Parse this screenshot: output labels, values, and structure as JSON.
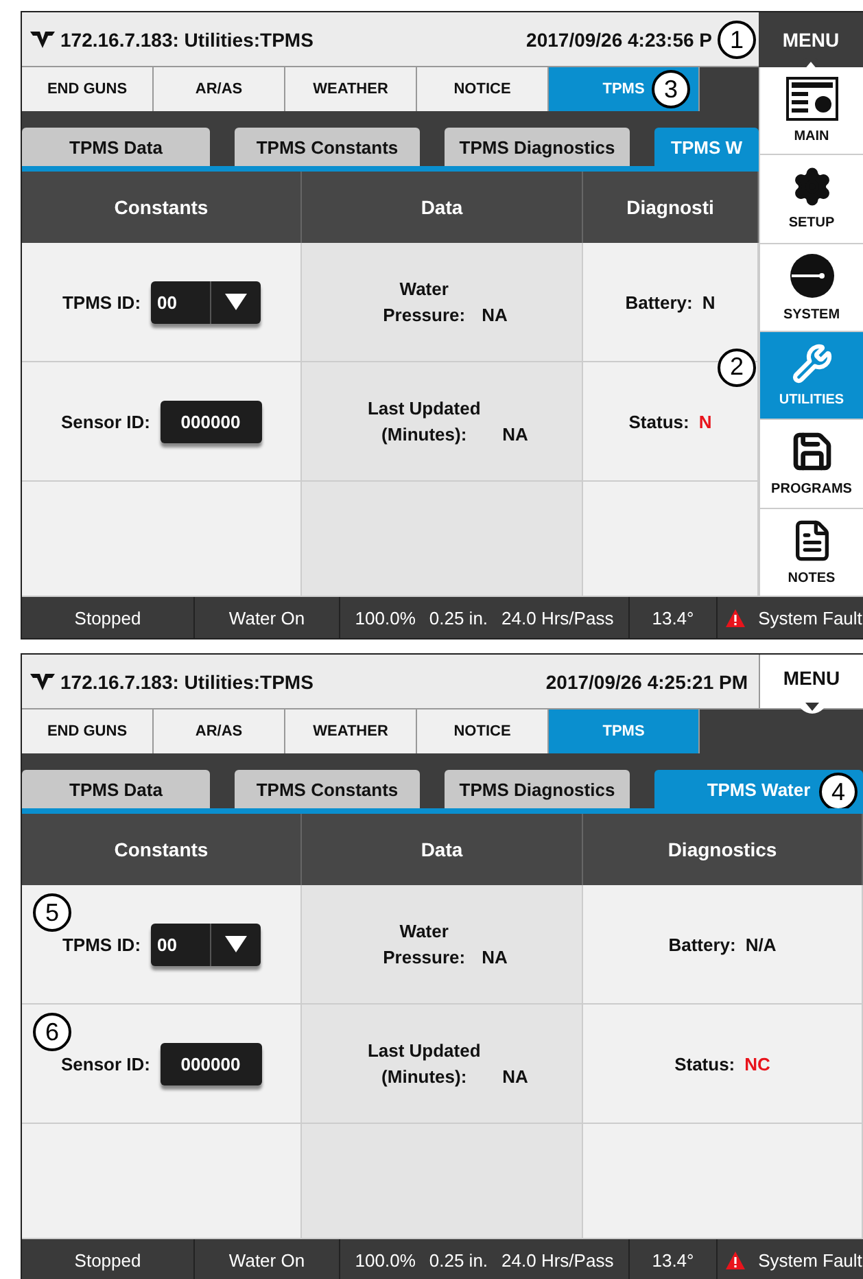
{
  "screens": [
    {
      "title": "172.16.7.183: Utilities:TPMS",
      "datetime": "2017/09/26 4:23:56 P",
      "menu": {
        "label": "MENU",
        "open": true,
        "callout": "1",
        "items": [
          {
            "label": "MAIN",
            "kind": "main",
            "selected": false
          },
          {
            "label": "SETUP",
            "kind": "setup",
            "selected": false
          },
          {
            "label": "SYSTEM",
            "kind": "system",
            "selected": false
          },
          {
            "label": "UTILITIES",
            "kind": "utilities",
            "selected": true,
            "callout": "2"
          },
          {
            "label": "PROGRAMS",
            "kind": "programs",
            "selected": false
          },
          {
            "label": "NOTES",
            "kind": "notes",
            "selected": false
          }
        ]
      },
      "tabs": [
        {
          "label": "END GUNS",
          "selected": false
        },
        {
          "label": "AR/AS",
          "selected": false
        },
        {
          "label": "WEATHER",
          "selected": false
        },
        {
          "label": "NOTICE",
          "selected": false
        },
        {
          "label": "TPMS",
          "selected": true,
          "callout": "3"
        }
      ],
      "subtabs": [
        {
          "label": "TPMS Data",
          "selected": false
        },
        {
          "label": "TPMS Constants",
          "selected": false
        },
        {
          "label": "TPMS Diagnostics",
          "selected": false
        },
        {
          "label": "TPMS W",
          "selected": true
        }
      ],
      "table": {
        "columns": [
          "Constants",
          "Data",
          "Diagnosti"
        ],
        "rows": [
          {
            "constant": {
              "label": "TPMS ID:",
              "kind": "dropdown",
              "value": "00"
            },
            "data": {
              "label": "Water Pressure:",
              "value": "NA"
            },
            "diagnostic": {
              "label": "Battery:",
              "value": "N",
              "alert": false
            }
          },
          {
            "constant": {
              "label": "Sensor ID:",
              "kind": "field",
              "value": "000000"
            },
            "data": {
              "label": "Last Updated (Minutes):",
              "value": "NA"
            },
            "diagnostic": {
              "label": "Status:",
              "value": "N",
              "alert": true
            }
          }
        ]
      },
      "status_bar": [
        {
          "kind": "plain",
          "texts": [
            "Stopped"
          ]
        },
        {
          "kind": "plain",
          "texts": [
            "Water On"
          ]
        },
        {
          "kind": "plain",
          "texts": [
            "100.0%",
            "0.25 in.",
            "24.0 Hrs/Pass"
          ]
        },
        {
          "kind": "plain",
          "texts": [
            "13.4°"
          ]
        },
        {
          "kind": "fault",
          "texts": [
            "System Fault"
          ]
        }
      ]
    },
    {
      "title": "172.16.7.183: Utilities:TPMS",
      "datetime": "2017/09/26 4:25:21 PM",
      "menu": {
        "label": "MENU",
        "open": false
      },
      "tabs": [
        {
          "label": "END GUNS",
          "selected": false
        },
        {
          "label": "AR/AS",
          "selected": false
        },
        {
          "label": "WEATHER",
          "selected": false
        },
        {
          "label": "NOTICE",
          "selected": false
        },
        {
          "label": "TPMS",
          "selected": true
        }
      ],
      "subtabs": [
        {
          "label": "TPMS Data",
          "selected": false
        },
        {
          "label": "TPMS Constants",
          "selected": false
        },
        {
          "label": "TPMS Diagnostics",
          "selected": false
        },
        {
          "label": "TPMS Water",
          "selected": true,
          "callout": "4"
        }
      ],
      "table": {
        "columns": [
          "Constants",
          "Data",
          "Diagnostics"
        ],
        "rows": [
          {
            "constant": {
              "label": "TPMS ID:",
              "kind": "dropdown",
              "value": "00",
              "callout": "5"
            },
            "data": {
              "label": "Water Pressure:",
              "value": "NA"
            },
            "diagnostic": {
              "label": "Battery:",
              "value": "N/A",
              "alert": false
            }
          },
          {
            "constant": {
              "label": "Sensor ID:",
              "kind": "field",
              "value": "000000",
              "callout": "6"
            },
            "data": {
              "label": "Last Updated (Minutes):",
              "value": "NA"
            },
            "diagnostic": {
              "label": "Status:",
              "value": "NC",
              "alert": true
            }
          }
        ]
      },
      "status_bar": [
        {
          "kind": "plain",
          "texts": [
            "Stopped"
          ]
        },
        {
          "kind": "plain",
          "texts": [
            "Water On"
          ]
        },
        {
          "kind": "plain",
          "texts": [
            "100.0%",
            "0.25 in.",
            "24.0 Hrs/Pass"
          ]
        },
        {
          "kind": "plain",
          "texts": [
            "13.4°"
          ]
        },
        {
          "kind": "fault",
          "texts": [
            "System Fault"
          ]
        }
      ]
    }
  ]
}
